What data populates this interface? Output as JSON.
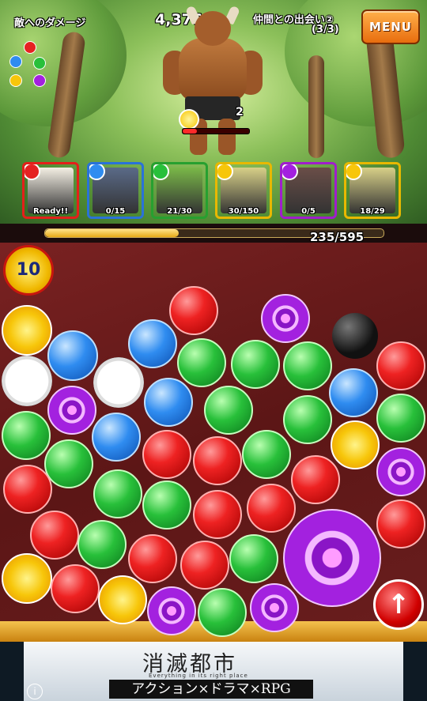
{
  "hud": {
    "damage_label": "敵へのダメージ",
    "damage_value": "4,376",
    "stage_title": "仲間との出会い②",
    "stage_progress": "(3/3)",
    "menu_label": "MENU"
  },
  "enemy": {
    "turn_count": "2",
    "hp_fraction": 0.22
  },
  "party": [
    {
      "status": "Ready!!",
      "element": "fire",
      "frame": "#e4201a"
    },
    {
      "status": "0/15",
      "element": "water",
      "frame": "#2a72d8"
    },
    {
      "status": "21/30",
      "element": "wood",
      "frame": "#27a030"
    },
    {
      "status": "30/150",
      "element": "light",
      "frame": "#e8b800"
    },
    {
      "status": "0/5",
      "element": "dark",
      "frame": "#a01ecc"
    },
    {
      "status": "18/29",
      "element": "light",
      "frame": "#e8b800"
    }
  ],
  "player_hp": {
    "text": "235/595",
    "fraction": 0.395
  },
  "combo_counter": "10",
  "ad": {
    "title": "消滅都市",
    "subtitle": "Everything in its right place",
    "tagline": "アクション×ドラマ×RPG",
    "info": "i"
  },
  "colors": {
    "fire": "#e52222",
    "water": "#2f8cf0",
    "wood": "#28c03a",
    "light": "#f7c60a",
    "dark": "#a321df"
  }
}
